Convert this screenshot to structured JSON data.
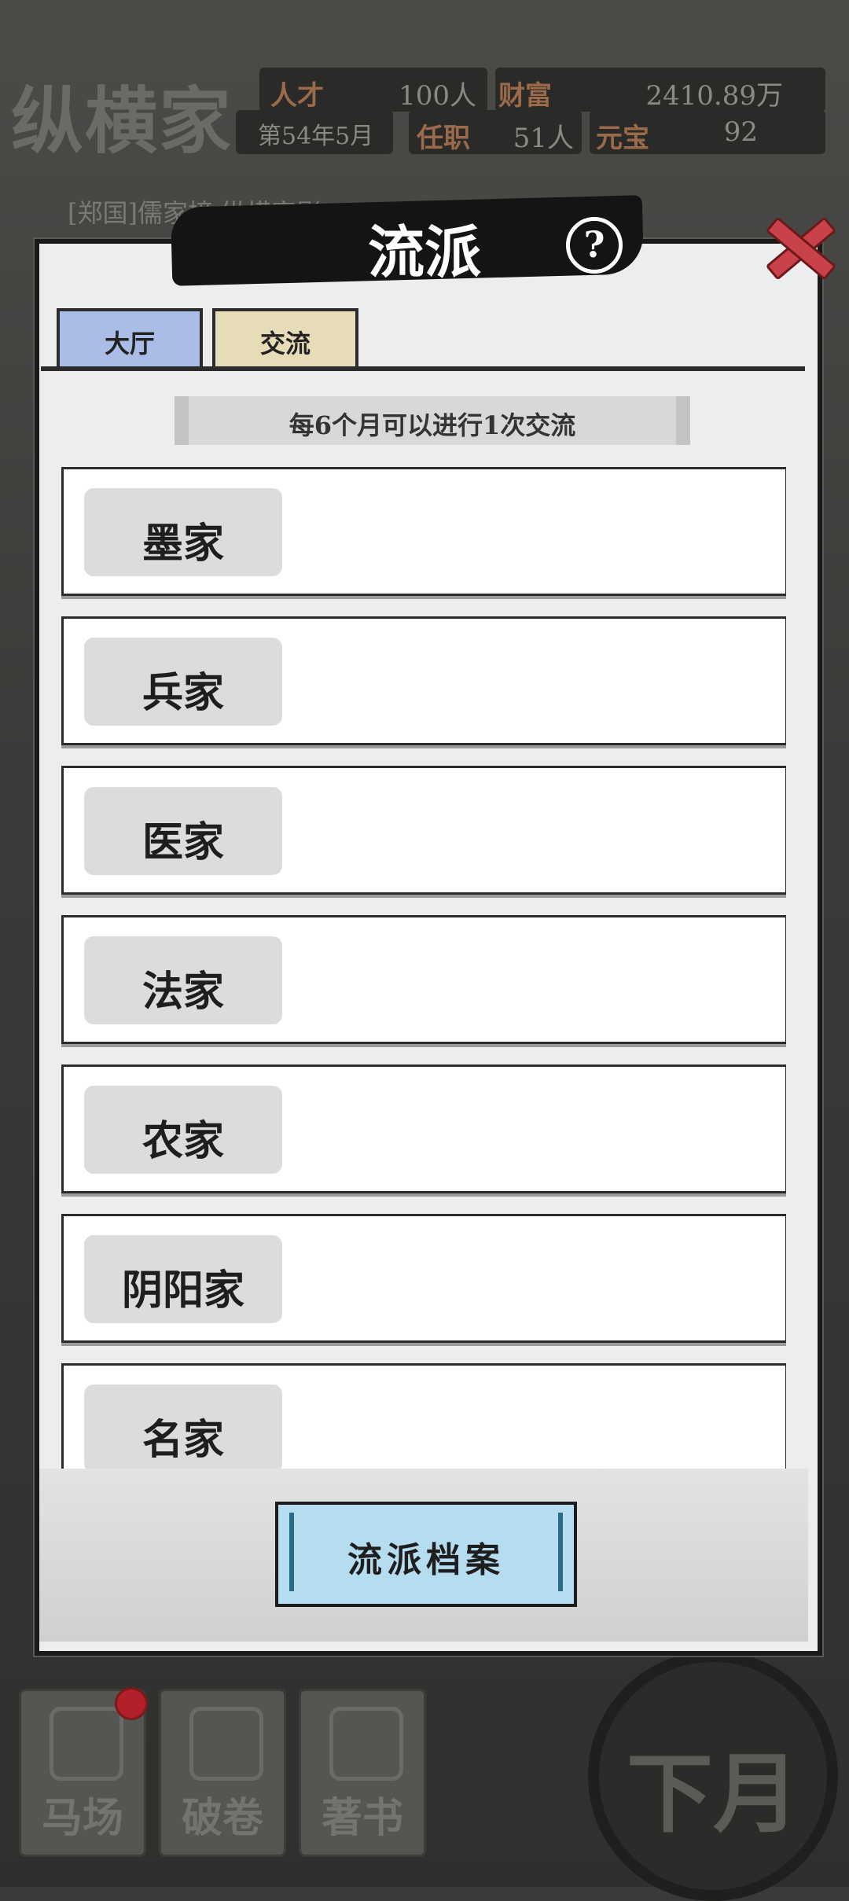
{
  "hud": {
    "sect_name": "纵横家",
    "talent_label": "人才",
    "talent_value": "100人",
    "wealth_label": "财富",
    "wealth_value": "2410.89万",
    "date": "第54年5月",
    "office_label": "任职",
    "office_value": "51人",
    "ingot_label": "元宝",
    "ingot_value": "92",
    "message": "[郑国]儒家榜   纵横家影"
  },
  "modal": {
    "title": "流派",
    "help_icon": "?",
    "tabs": [
      {
        "label": "大厅"
      },
      {
        "label": "交流"
      }
    ],
    "notice": "每6个月可以进行1次交流",
    "schools": [
      {
        "name": "墨家"
      },
      {
        "name": "兵家"
      },
      {
        "name": "医家"
      },
      {
        "name": "法家"
      },
      {
        "name": "农家"
      },
      {
        "name": "阴阳家"
      },
      {
        "name": "名家"
      }
    ],
    "archive_button": "流派档案"
  },
  "dock": {
    "buttons": [
      {
        "label": "马场",
        "icon": "saddle-icon"
      },
      {
        "label": "破卷",
        "icon": "scroll-bundle-icon"
      },
      {
        "label": "著书",
        "icon": "brush-book-icon"
      }
    ],
    "next_month": "下月"
  },
  "colors": {
    "tab_hall": "#aabde6",
    "tab_exchange": "#e7dcb8",
    "archive_button": "#b6dcef",
    "close_red": "#c9424a"
  }
}
